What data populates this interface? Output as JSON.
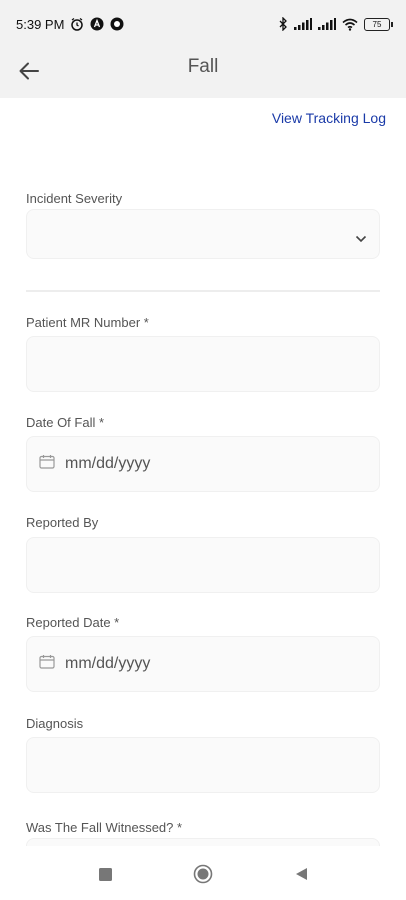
{
  "status_bar": {
    "time": "5:39 PM",
    "battery": "75",
    "icons": [
      "alarm-icon",
      "notification-a-icon",
      "notification-o-icon",
      "bluetooth-icon",
      "signal-icon",
      "signal-icon",
      "wifi-icon",
      "battery-icon"
    ]
  },
  "app_bar": {
    "title": "Fall",
    "back_icon": "arrow-left-icon"
  },
  "links": {
    "tracking": "View Tracking Log"
  },
  "form": {
    "incident_severity": {
      "label": "Incident Severity",
      "value": ""
    },
    "patient_mr": {
      "label": "Patient MR Number *",
      "value": ""
    },
    "date_of_fall": {
      "label": "Date Of Fall *",
      "placeholder": "mm/dd/yyyy"
    },
    "reported_by": {
      "label": "Reported By",
      "value": ""
    },
    "reported_date": {
      "label": "Reported Date *",
      "placeholder": "mm/dd/yyyy"
    },
    "diagnosis": {
      "label": "Diagnosis",
      "value": ""
    },
    "fall_witnessed": {
      "label": "Was The Fall Witnessed? *"
    }
  },
  "nav_bar": {
    "icons": [
      "recent-apps-icon",
      "home-icon",
      "back-triangle-icon"
    ]
  },
  "colors": {
    "link": "#1a3aa8",
    "field_bg": "#fafafa",
    "header_bg": "#f2f2f2"
  }
}
